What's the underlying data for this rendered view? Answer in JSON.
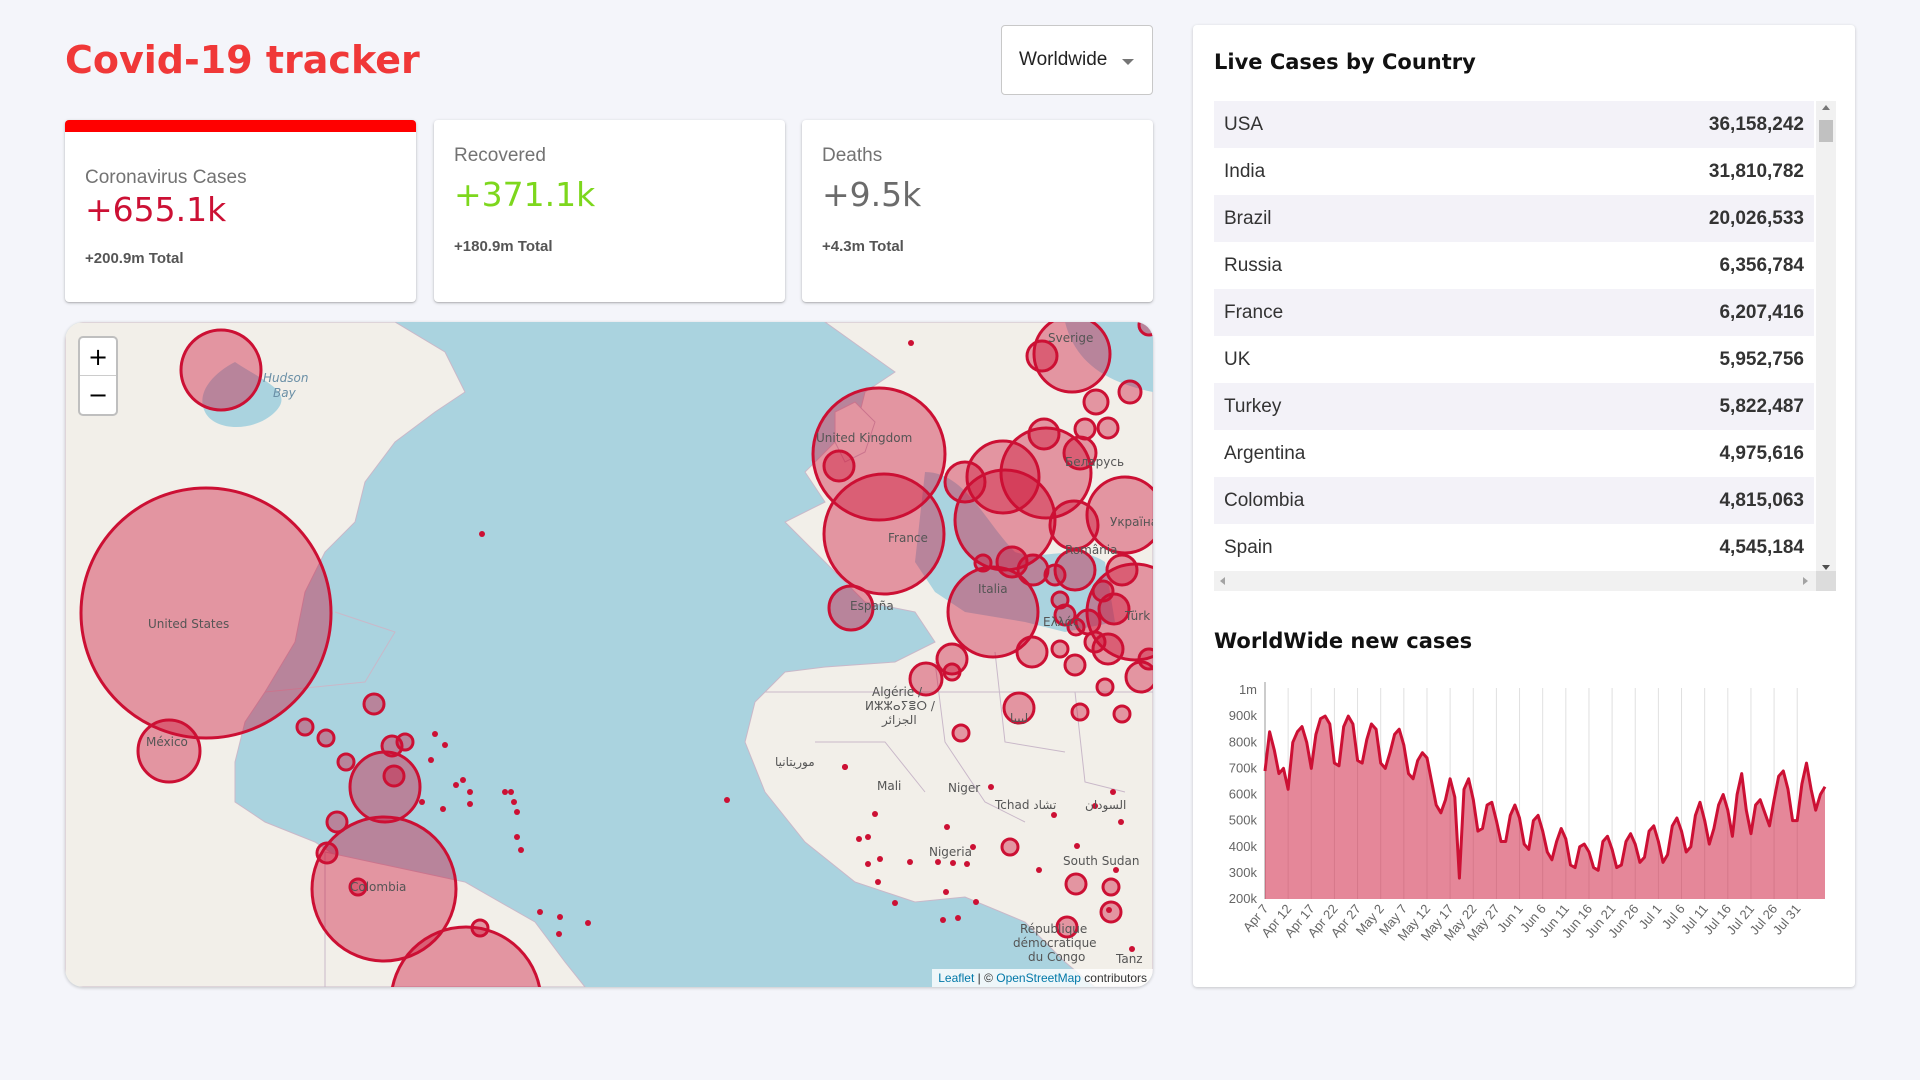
{
  "header": {
    "title": "Covid-19 tracker"
  },
  "selector": {
    "selected": "Worldwide"
  },
  "stats": [
    {
      "title": "Coronavirus Cases",
      "value": "+655.1k",
      "total": "+200.9m Total",
      "color": "#cc1034",
      "selected": true
    },
    {
      "title": "Recovered",
      "value": "+371.1k",
      "total": "+180.9m Total",
      "color": "#7dd71d",
      "selected": false
    },
    {
      "title": "Deaths",
      "value": "+9.5k",
      "total": "+4.3m Total",
      "color": "#6b6b6b",
      "selected": false
    }
  ],
  "map": {
    "zoom_in": "+",
    "zoom_out": "−",
    "attribution": {
      "leaflet": "Leaflet",
      "separator": " | © ",
      "osm": "OpenStreetMap",
      "suffix": " contributors"
    },
    "labels": [
      {
        "text": "Hudson",
        "kind": "water"
      },
      {
        "text": "Bay",
        "kind": "water"
      },
      {
        "text": "United States",
        "kind": "country"
      },
      {
        "text": "México",
        "kind": "country"
      },
      {
        "text": "Colombia",
        "kind": "country"
      },
      {
        "text": "Sverige",
        "kind": "country"
      },
      {
        "text": "United Kingdom",
        "kind": "country"
      },
      {
        "text": "France",
        "kind": "country"
      },
      {
        "text": "España",
        "kind": "country"
      },
      {
        "text": "Italia",
        "kind": "country"
      },
      {
        "text": "Беларусь",
        "kind": "country"
      },
      {
        "text": "Україна",
        "kind": "country"
      },
      {
        "text": "România",
        "kind": "country"
      },
      {
        "text": "Ελλάς",
        "kind": "country"
      },
      {
        "text": "Türk",
        "kind": "country"
      },
      {
        "text": "Algérie /",
        "kind": "country"
      },
      {
        "text": "ⵍⵣⵣⴰⵢⴻⵔ /",
        "kind": "country"
      },
      {
        "text": "الجزائر",
        "kind": "country"
      },
      {
        "text": "ليبيا",
        "kind": "country"
      },
      {
        "text": "موريتانيا",
        "kind": "country"
      },
      {
        "text": "Mali",
        "kind": "country"
      },
      {
        "text": "Niger",
        "kind": "country"
      },
      {
        "text": "Tchad تشاد",
        "kind": "country"
      },
      {
        "text": "السودان",
        "kind": "country"
      },
      {
        "text": "Nigeria",
        "kind": "country"
      },
      {
        "text": "South Sudan",
        "kind": "country"
      },
      {
        "text": "République",
        "kind": "country"
      },
      {
        "text": "démocratique",
        "kind": "country"
      },
      {
        "text": "du Congo",
        "kind": "country"
      },
      {
        "text": "Tanz",
        "kind": "country"
      }
    ],
    "circle_color": "#cc1034"
  },
  "table": {
    "title": "Live Cases by Country",
    "rows": [
      {
        "country": "USA",
        "cases": "36,158,242"
      },
      {
        "country": "India",
        "cases": "31,810,782"
      },
      {
        "country": "Brazil",
        "cases": "20,026,533"
      },
      {
        "country": "Russia",
        "cases": "6,356,784"
      },
      {
        "country": "France",
        "cases": "6,207,416"
      },
      {
        "country": "UK",
        "cases": "5,952,756"
      },
      {
        "country": "Turkey",
        "cases": "5,822,487"
      },
      {
        "country": "Argentina",
        "cases": "4,975,616"
      },
      {
        "country": "Colombia",
        "cases": "4,815,063"
      },
      {
        "country": "Spain",
        "cases": "4,545,184"
      }
    ],
    "stripe_color": "#f3f2f8"
  },
  "chart_title": "WorldWide new cases",
  "chart_data": {
    "type": "area",
    "title": "WorldWide new cases",
    "xlabel": "",
    "ylabel": "",
    "y_ticks": [
      "200k",
      "300k",
      "400k",
      "500k",
      "600k",
      "700k",
      "800k",
      "900k",
      "1m"
    ],
    "ylim": [
      200000,
      1000000
    ],
    "x_ticks": [
      "Apr 7",
      "Apr 12",
      "Apr 17",
      "Apr 22",
      "Apr 27",
      "May 2",
      "May 7",
      "May 12",
      "May 17",
      "May 22",
      "May 27",
      "Jun 1",
      "Jun 6",
      "Jun 11",
      "Jun 16",
      "Jun 21",
      "Jun 26",
      "Jul 1",
      "Jul 6",
      "Jul 11",
      "Jul 16",
      "Jul 21",
      "Jul 26",
      "Jul 31"
    ],
    "grid": "vertical",
    "line_color": "#cc1034",
    "fill_color": "rgba(204,16,52,0.5)",
    "x": [
      "Apr 7",
      "Apr 8",
      "Apr 9",
      "Apr 10",
      "Apr 11",
      "Apr 12",
      "Apr 13",
      "Apr 14",
      "Apr 15",
      "Apr 16",
      "Apr 17",
      "Apr 18",
      "Apr 19",
      "Apr 20",
      "Apr 21",
      "Apr 22",
      "Apr 23",
      "Apr 24",
      "Apr 25",
      "Apr 26",
      "Apr 27",
      "Apr 28",
      "Apr 29",
      "Apr 30",
      "May 1",
      "May 2",
      "May 3",
      "May 4",
      "May 5",
      "May 6",
      "May 7",
      "May 8",
      "May 9",
      "May 10",
      "May 11",
      "May 12",
      "May 13",
      "May 14",
      "May 15",
      "May 16",
      "May 17",
      "May 18",
      "May 19",
      "May 20",
      "May 21",
      "May 22",
      "May 23",
      "May 24",
      "May 25",
      "May 26",
      "May 27",
      "May 28",
      "May 29",
      "May 30",
      "May 31",
      "Jun 1",
      "Jun 2",
      "Jun 3",
      "Jun 4",
      "Jun 5",
      "Jun 6",
      "Jun 7",
      "Jun 8",
      "Jun 9",
      "Jun 10",
      "Jun 11",
      "Jun 12",
      "Jun 13",
      "Jun 14",
      "Jun 15",
      "Jun 16",
      "Jun 17",
      "Jun 18",
      "Jun 19",
      "Jun 20",
      "Jun 21",
      "Jun 22",
      "Jun 23",
      "Jun 24",
      "Jun 25",
      "Jun 26",
      "Jun 27",
      "Jun 28",
      "Jun 29",
      "Jun 30",
      "Jul 1",
      "Jul 2",
      "Jul 3",
      "Jul 4",
      "Jul 5",
      "Jul 6",
      "Jul 7",
      "Jul 8",
      "Jul 9",
      "Jul 10",
      "Jul 11",
      "Jul 12",
      "Jul 13",
      "Jul 14",
      "Jul 15",
      "Jul 16",
      "Jul 17",
      "Jul 18",
      "Jul 19",
      "Jul 20",
      "Jul 21",
      "Jul 22",
      "Jul 23",
      "Jul 24",
      "Jul 25",
      "Jul 26",
      "Jul 27",
      "Jul 28",
      "Jul 29",
      "Jul 30",
      "Jul 31",
      "Aug 1",
      "Aug 2"
    ],
    "values": [
      690000,
      840000,
      770000,
      680000,
      700000,
      620000,
      800000,
      840000,
      860000,
      800000,
      700000,
      830000,
      890000,
      900000,
      870000,
      720000,
      710000,
      860000,
      900000,
      870000,
      730000,
      720000,
      810000,
      870000,
      850000,
      720000,
      700000,
      760000,
      830000,
      850000,
      790000,
      680000,
      660000,
      730000,
      760000,
      740000,
      650000,
      560000,
      530000,
      580000,
      660000,
      590000,
      280000,
      620000,
      660000,
      580000,
      460000,
      470000,
      560000,
      570000,
      500000,
      420000,
      420000,
      520000,
      560000,
      510000,
      410000,
      390000,
      500000,
      520000,
      460000,
      380000,
      350000,
      420000,
      470000,
      430000,
      330000,
      320000,
      400000,
      410000,
      380000,
      320000,
      310000,
      420000,
      440000,
      390000,
      320000,
      330000,
      420000,
      450000,
      410000,
      340000,
      360000,
      460000,
      480000,
      420000,
      340000,
      370000,
      480000,
      510000,
      460000,
      380000,
      400000,
      520000,
      570000,
      500000,
      410000,
      470000,
      560000,
      600000,
      540000,
      440000,
      600000,
      680000,
      540000,
      450000,
      560000,
      580000,
      530000,
      480000,
      580000,
      670000,
      690000,
      620000,
      500000,
      500000,
      640000,
      720000,
      620000,
      540000,
      600000,
      630000
    ]
  }
}
